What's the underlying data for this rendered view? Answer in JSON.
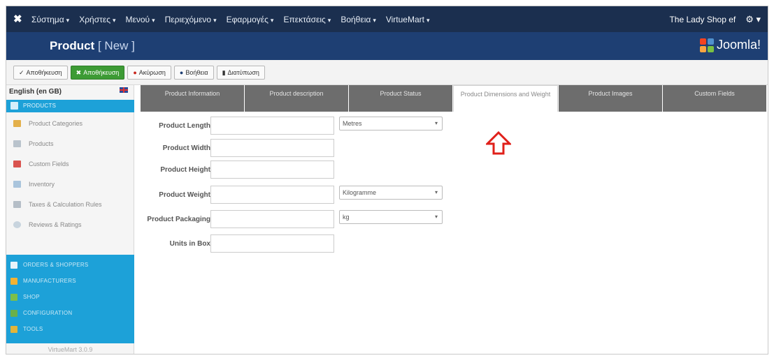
{
  "topbar": {
    "menu": [
      "Σύστημα",
      "Χρήστες",
      "Μενού",
      "Περιεχόμενο",
      "Εφαρμογές",
      "Επεκτάσεις",
      "Βοήθεια",
      "VirtueMart"
    ],
    "site_name": "The Lady Shop ef",
    "gear": "⚙"
  },
  "header": {
    "title": "Product",
    "subtitle": "[ New ]",
    "brand": "Joomla!"
  },
  "toolbar": {
    "save": "Αποθήκευση",
    "save_close": "Αποθήκευση",
    "cancel": "Ακύρωση",
    "help": "Βοήθεια",
    "preview": "Διατύπωση"
  },
  "sidebar": {
    "language": "English (en GB)",
    "products_head": "PRODUCTS",
    "items": [
      {
        "label": "Product Categories",
        "icon": "folder-icon"
      },
      {
        "label": "Products",
        "icon": "products-icon"
      },
      {
        "label": "Custom Fields",
        "icon": "custom-fields-icon"
      },
      {
        "label": "Inventory",
        "icon": "inventory-icon"
      },
      {
        "label": "Taxes & Calculation Rules",
        "icon": "taxes-icon"
      },
      {
        "label": "Reviews & Ratings",
        "icon": "reviews-icon"
      }
    ],
    "sections": [
      {
        "label": "ORDERS & SHOPPERS",
        "icon": "orders-icon"
      },
      {
        "label": "MANUFACTURERS",
        "icon": "manufacturers-icon"
      },
      {
        "label": "SHOP",
        "icon": "shop-icon"
      },
      {
        "label": "CONFIGURATION",
        "icon": "configuration-icon"
      },
      {
        "label": "TOOLS",
        "icon": "tools-icon"
      }
    ],
    "version": "VirtueMart 3.0.9"
  },
  "tabs": [
    {
      "label": "Product Information",
      "active": false
    },
    {
      "label": "Product description",
      "active": false
    },
    {
      "label": "Product Status",
      "active": false
    },
    {
      "label": "Product Dimensions and Weight",
      "active": true
    },
    {
      "label": "Product Images",
      "active": false
    },
    {
      "label": "Custom Fields",
      "active": false
    }
  ],
  "form": {
    "length_label": "Product Length",
    "length_value": "",
    "length_unit": "Metres",
    "width_label": "Product Width",
    "width_value": "",
    "height_label": "Product Height",
    "height_value": "",
    "weight_label": "Product Weight",
    "weight_value": "",
    "weight_unit": "Kilogramme",
    "packaging_label": "Product Packaging",
    "packaging_value": "",
    "packaging_unit": "kg",
    "units_label": "Units in Box",
    "units_value": ""
  },
  "colors": {
    "topbar": "#1b2f4f",
    "header": "#1e3f73",
    "accent": "#1da1d8",
    "save_green": "#3d9b35",
    "arrow_red": "#e0201a"
  }
}
